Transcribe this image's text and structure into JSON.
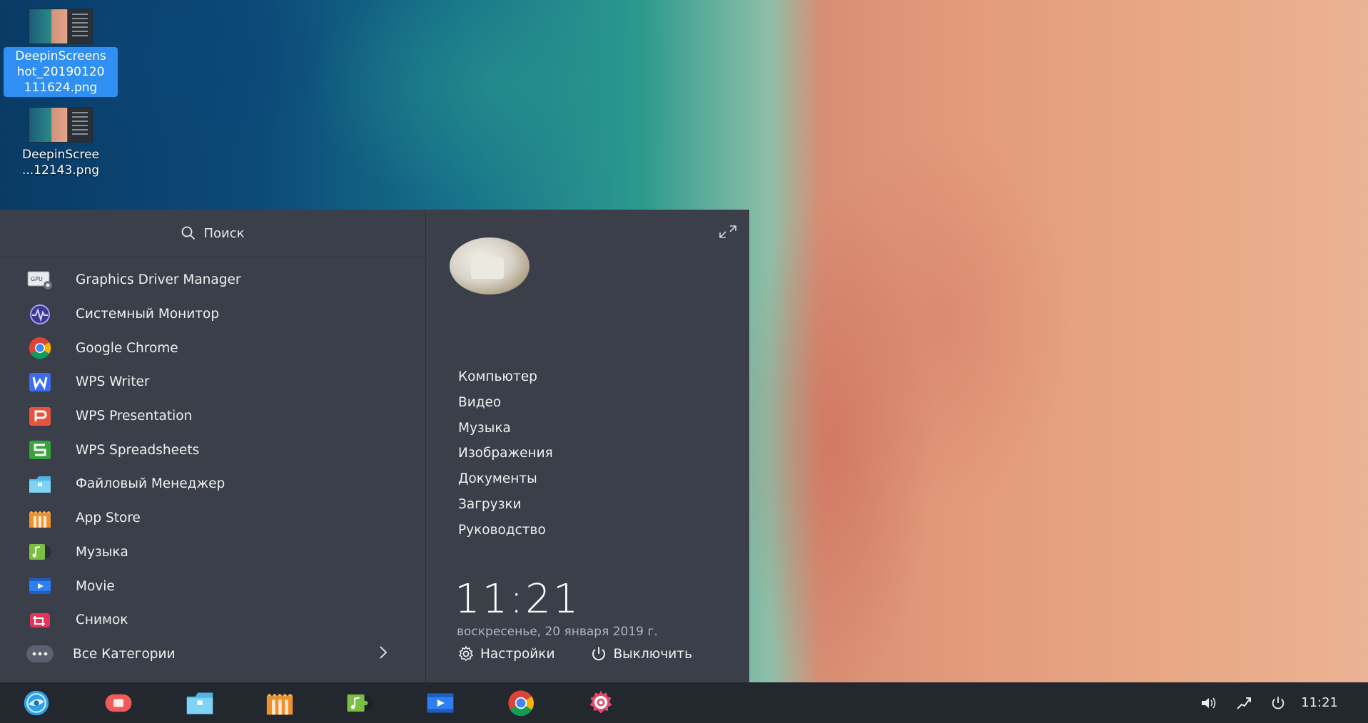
{
  "desktop": {
    "icons": [
      {
        "label": "DeepinScreenshot_20190120111624.png",
        "label_lines": [
          "DeepinScreens",
          "hot_20190120",
          "111624.png"
        ],
        "selected": true
      },
      {
        "label": "DeepinScree...12143.png",
        "label_lines": [
          "DeepinScree",
          "...12143.png"
        ],
        "selected": false
      }
    ]
  },
  "launcher": {
    "search": {
      "placeholder": "Поиск",
      "icon": "search-icon"
    },
    "apps": [
      {
        "label": "Graphics Driver Manager",
        "icon": "gpu-icon"
      },
      {
        "label": "Системный Монитор",
        "icon": "system-monitor-icon"
      },
      {
        "label": "Google Chrome",
        "icon": "chrome-icon"
      },
      {
        "label": "WPS Writer",
        "icon": "wps-writer-icon"
      },
      {
        "label": "WPS Presentation",
        "icon": "wps-presentation-icon"
      },
      {
        "label": "WPS Spreadsheets",
        "icon": "wps-spreadsheets-icon"
      },
      {
        "label": "Файловый Менеджер",
        "icon": "file-manager-icon"
      },
      {
        "label": "App Store",
        "icon": "app-store-icon"
      },
      {
        "label": "Музыка",
        "icon": "music-icon"
      },
      {
        "label": "Movie",
        "icon": "movie-icon"
      },
      {
        "label": "Снимок",
        "icon": "screenshot-icon"
      }
    ],
    "all_categories": {
      "label": "Все Категории",
      "icon": "more-icon"
    },
    "places": [
      "Компьютер",
      "Видео",
      "Музыка",
      "Изображения",
      "Документы",
      "Загрузки",
      "Руководство"
    ],
    "clock": "11:21",
    "date": "воскресенье, 20 января 2019 г.",
    "settings_label": "Настройки",
    "shutdown_label": "Выключить"
  },
  "taskbar": {
    "dock": [
      "deepin-launcher-icon",
      "screen-recorder-icon",
      "file-manager-icon",
      "app-store-icon",
      "music-icon",
      "movie-icon",
      "chrome-icon",
      "settings-icon"
    ],
    "tray_clock": "11:21"
  }
}
